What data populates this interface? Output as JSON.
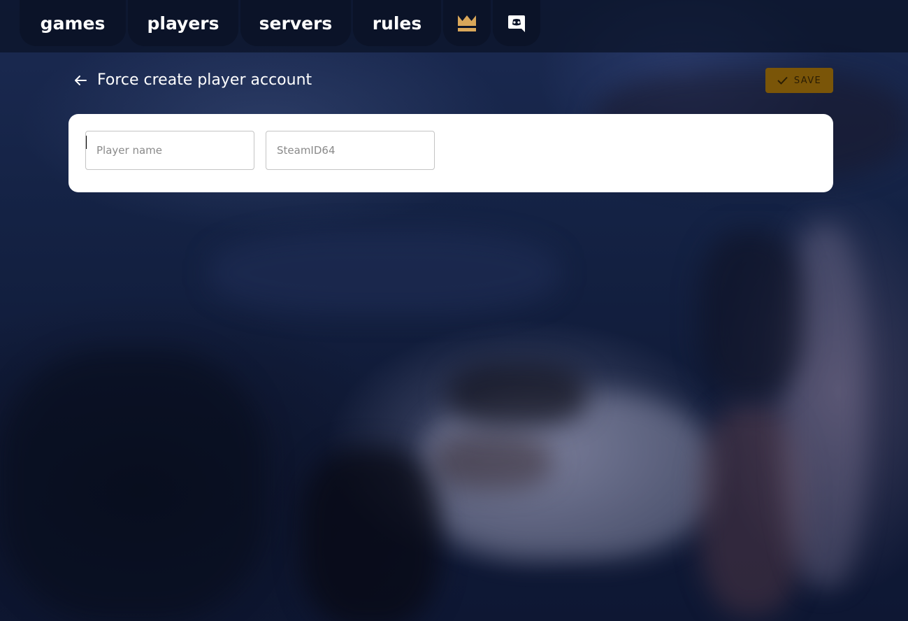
{
  "nav": {
    "items": [
      {
        "label": "games"
      },
      {
        "label": "players"
      },
      {
        "label": "servers"
      },
      {
        "label": "rules"
      }
    ],
    "crown_icon": "crown-icon",
    "discord_icon": "discord-icon"
  },
  "header": {
    "back_icon": "arrow-left-icon",
    "title": "Force create player account",
    "save_label": "SAVE",
    "save_icon": "check-icon"
  },
  "form": {
    "player_name": {
      "value": "",
      "placeholder": "Player name"
    },
    "steamid": {
      "value": "",
      "placeholder": "SteamID64"
    }
  },
  "colors": {
    "accent": "#d9a75a",
    "save_bg": "#7a5508",
    "nav_bg": "#0b1328"
  }
}
